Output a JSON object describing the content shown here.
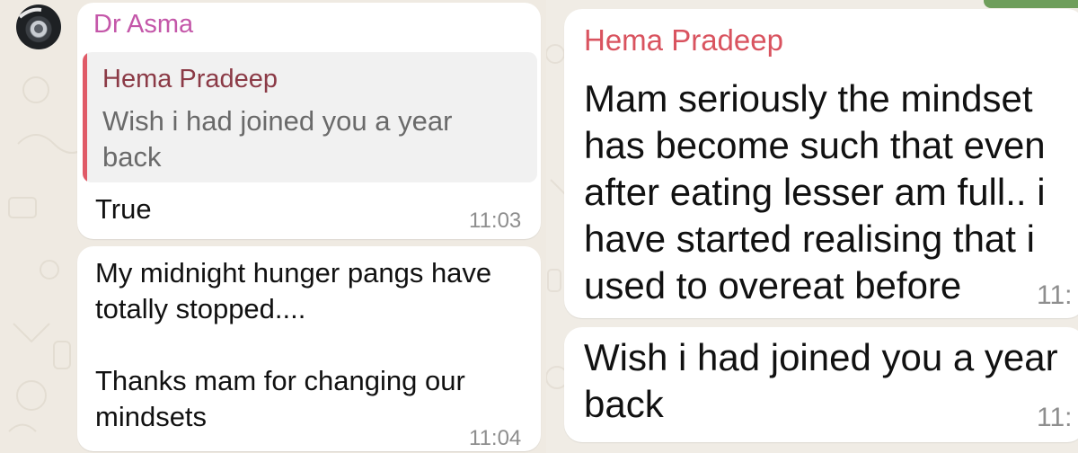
{
  "left": {
    "sender_name": "Dr Asma",
    "sender_color": "#c457a9",
    "reply": {
      "author": "Hema Pradeep",
      "text": "Wish i had joined you a year back",
      "accent": "#e05a67"
    },
    "messages": [
      {
        "text": "True",
        "time": "11:03"
      },
      {
        "text": "My midnight hunger pangs have totally stopped....\n\nThanks mam for changing our mindsets",
        "time": "11:04"
      }
    ]
  },
  "right": {
    "sender_name": "Hema Pradeep",
    "sender_color": "#d9535f",
    "messages": [
      {
        "text": "Mam seriously the mindset has become such that even after eating lesser am full.. i have started realising that i used to overeat before",
        "time": "11:"
      },
      {
        "text": "Wish i had joined you a year back",
        "time": "11:"
      }
    ]
  }
}
